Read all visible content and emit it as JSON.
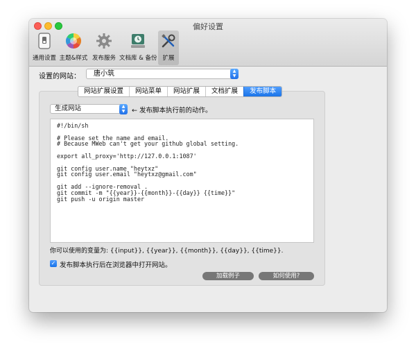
{
  "window": {
    "title": "偏好设置"
  },
  "toolbar": {
    "items": [
      {
        "label": "通用设置",
        "icon": "switch-icon"
      },
      {
        "label": "主题&样式",
        "icon": "color-wheel-icon"
      },
      {
        "label": "发布服务",
        "icon": "gear-icon"
      },
      {
        "label": "文档库 & 备份",
        "icon": "time-machine-icon"
      },
      {
        "label": "扩展",
        "icon": "tools-icon"
      }
    ],
    "active": "扩展"
  },
  "site": {
    "label": "设置的网站：",
    "value": "唐小筑"
  },
  "tabs": [
    {
      "label": "网站扩展设置"
    },
    {
      "label": "网站菜单"
    },
    {
      "label": "网站扩展"
    },
    {
      "label": "文档扩展"
    },
    {
      "label": "发布脚本"
    }
  ],
  "active_tab": "发布脚本",
  "action": {
    "value": "生成网站",
    "hint": "← 发布脚本执行前的动作。"
  },
  "script_lines": [
    "#!/bin/sh",
    "",
    "# Please set the name and email.",
    "# Because MWeb can't get your github global setting.",
    "",
    "export all_proxy='http://127.0.0.1:1087'",
    "",
    "git config user.name \"heytxz\"",
    "git config user.email \"heytxz@gmail.com\"",
    "",
    "git add --ignore-removal .",
    "git commit -m \"{{year}}-{{month}}-{{day}} {{time}}\"",
    "git push -u origin master"
  ],
  "variables_text": "你可以使用的变量为: {{input}}, {{year}}, {{month}}, {{day}}, {{time}}.",
  "open_in_browser": {
    "checked": true,
    "label": "发布脚本执行后在浏览器中打开网站。"
  },
  "buttons": {
    "load_example": "加载例子",
    "how_to_use": "如何使用?"
  },
  "colors": {
    "accent": "#1a73e8",
    "window_bg": "#ececec",
    "panel_bg": "#e2e2e2"
  }
}
